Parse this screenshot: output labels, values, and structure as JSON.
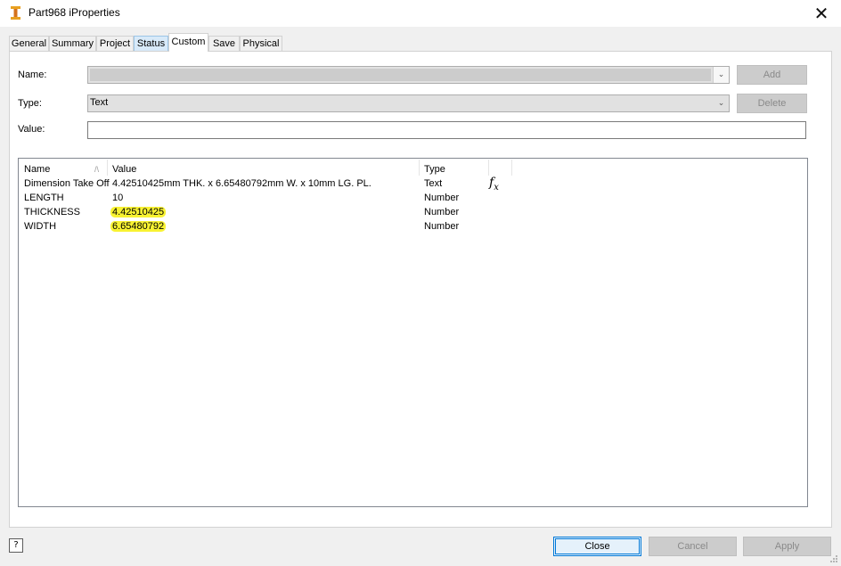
{
  "window": {
    "title": "Part968 iProperties",
    "close_glyph": "✕",
    "app_icon": "inventor-part-icon"
  },
  "tabs": [
    {
      "label": "General",
      "state": "normal"
    },
    {
      "label": "Summary",
      "state": "normal"
    },
    {
      "label": "Project",
      "state": "normal"
    },
    {
      "label": "Status",
      "state": "hover"
    },
    {
      "label": "Custom",
      "state": "active"
    },
    {
      "label": "Save",
      "state": "normal"
    },
    {
      "label": "Physical",
      "state": "normal"
    }
  ],
  "form": {
    "name_label": "Name:",
    "name_value": "",
    "type_label": "Type:",
    "type_value": "Text",
    "value_label": "Value:",
    "value_value": "",
    "add_button": "Add",
    "delete_button": "Delete",
    "dropdown_glyph": "⌄"
  },
  "table": {
    "columns": [
      "Name",
      "Value",
      "Type"
    ],
    "sort_indicator": "/\\",
    "rows": [
      {
        "name": "Dimension Take Off",
        "value": "4.42510425mm THK. x 6.65480792mm W. x 10mm LG. PL.",
        "type": "Text",
        "highlight": false,
        "has_formula": true
      },
      {
        "name": "LENGTH",
        "value": "10",
        "type": "Number",
        "highlight": false,
        "has_formula": false
      },
      {
        "name": "THICKNESS",
        "value": "4.42510425",
        "type": "Number",
        "highlight": true,
        "has_formula": false
      },
      {
        "name": "WIDTH",
        "value": "6.65480792",
        "type": "Number",
        "highlight": true,
        "has_formula": false
      }
    ],
    "formula_icon": {
      "f": "f",
      "x": "x"
    },
    "highlight_color": "#f8f232"
  },
  "footer": {
    "help_glyph": "?",
    "close_button": "Close",
    "cancel_button": "Cancel",
    "apply_button": "Apply"
  },
  "colors": {
    "accent": "#0078d7",
    "window_bg": "#f0f0f0"
  }
}
